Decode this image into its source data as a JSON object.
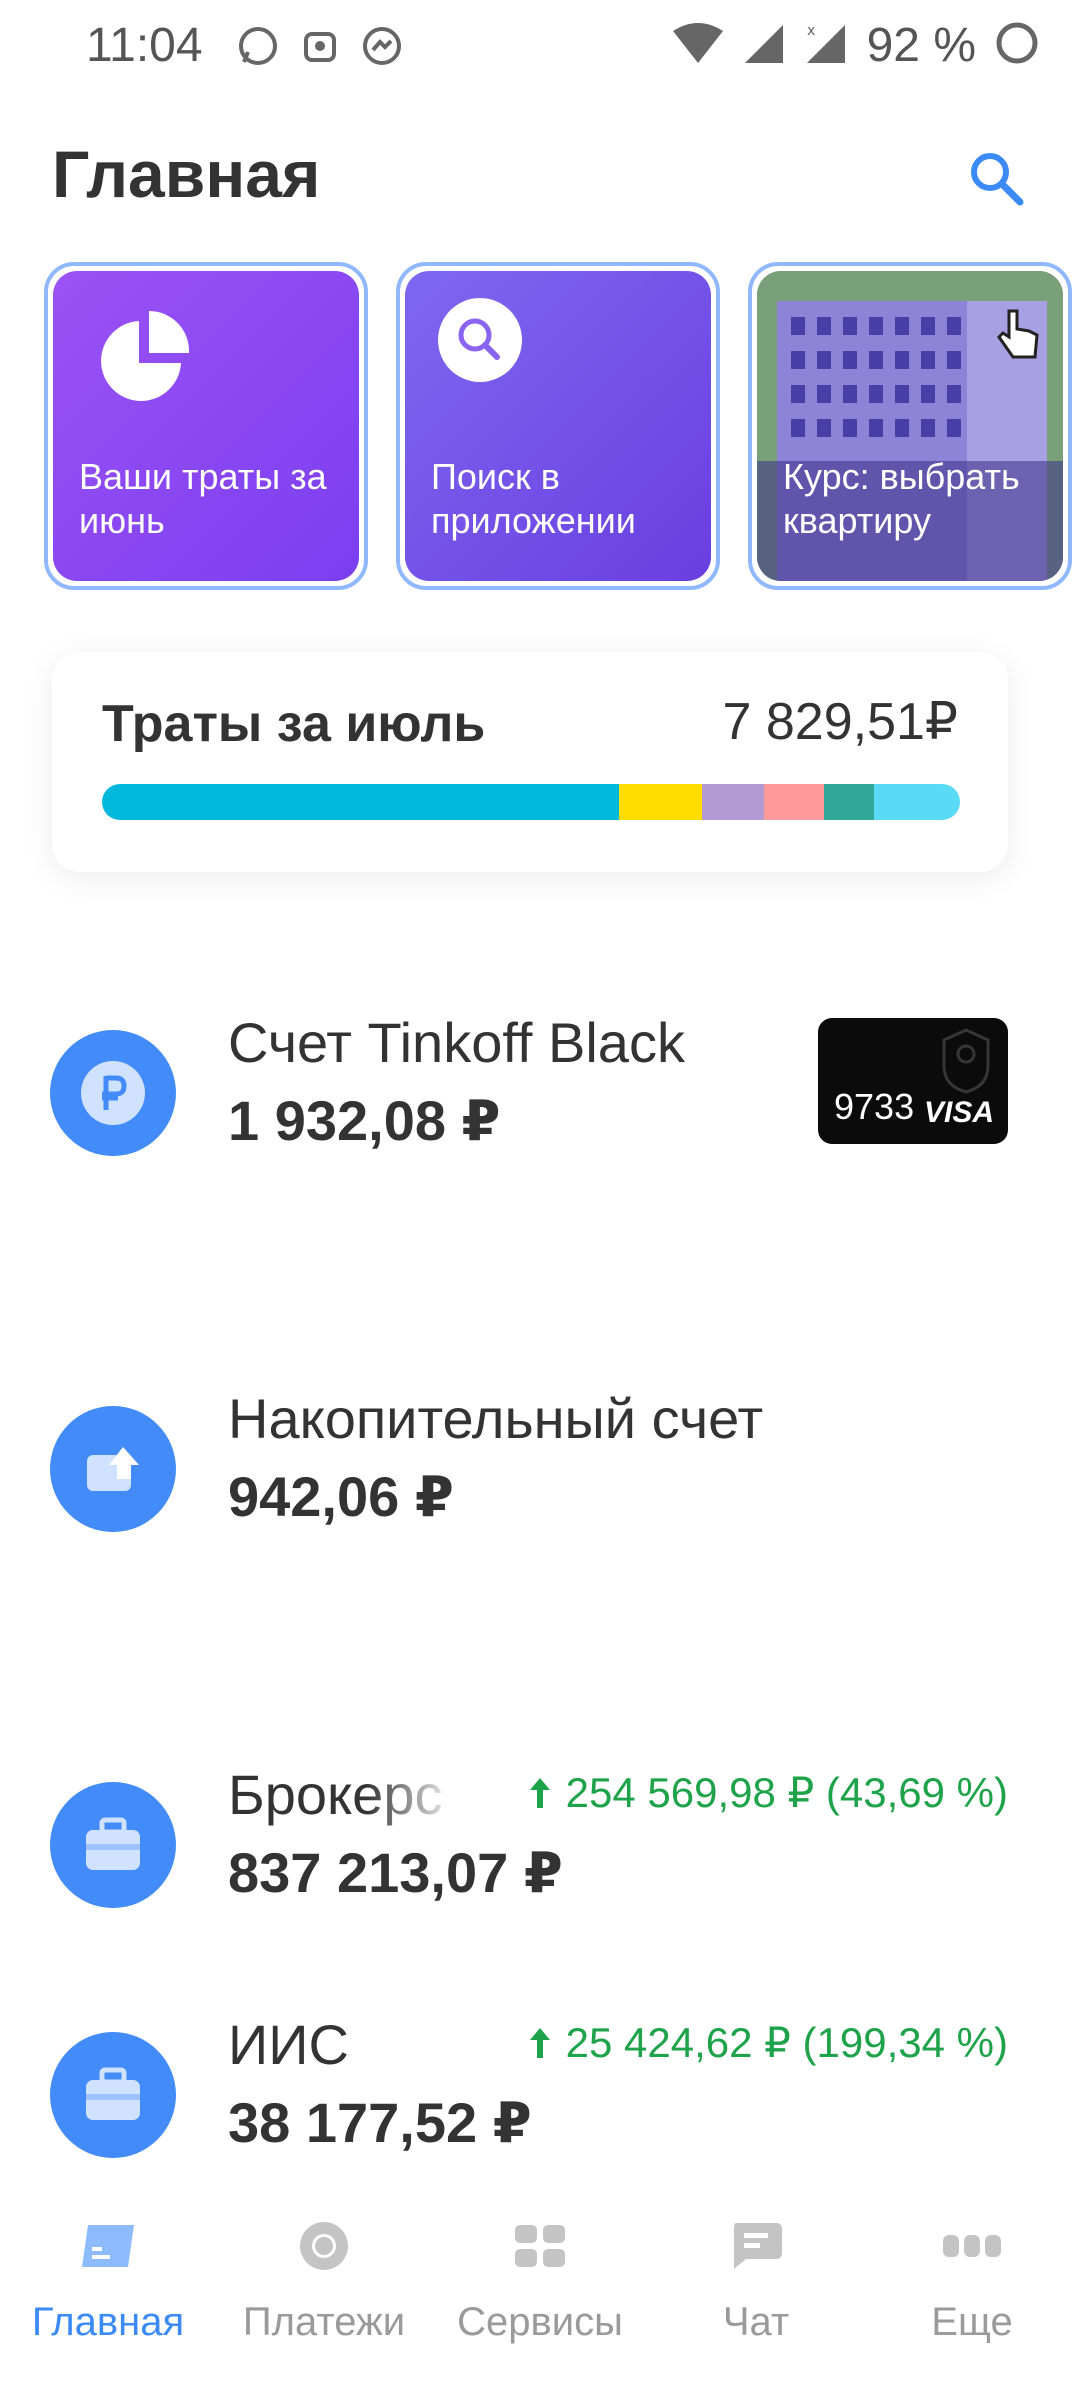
{
  "status_bar": {
    "time": "11:04",
    "battery": "92 %"
  },
  "header": {
    "title": "Главная"
  },
  "stories": [
    {
      "label": "Ваши траты за июнь"
    },
    {
      "label": "Поиск в приложении"
    },
    {
      "label": "Курс: выбрать квартиру"
    }
  ],
  "spending": {
    "title": "Траты за июль",
    "total": "7 829,51₽",
    "segments": [
      {
        "fraction": 0.603,
        "color": "#00b8dc"
      },
      {
        "fraction": 0.096,
        "color": "#ffdd00"
      },
      {
        "fraction": 0.073,
        "color": "#b39ad4"
      },
      {
        "fraction": 0.07,
        "color": "#ff9a9a"
      },
      {
        "fraction": 0.058,
        "color": "#30a79a"
      },
      {
        "fraction": 0.1,
        "color": "#5adbf5"
      }
    ]
  },
  "accounts": [
    {
      "name": "Счет Tinkoff Black",
      "balance": "1 932,08 ₽",
      "card_last4": "9733",
      "card_brand": "VISA"
    },
    {
      "name": "Накопительный счет",
      "balance": "942,06 ₽"
    },
    {
      "name": "Брокерс",
      "balance": "837 213,07 ₽",
      "change": "254 569,98 ₽ (43,69 %)"
    },
    {
      "name": "ИИС",
      "balance": "38 177,52 ₽",
      "change": "25 424,62 ₽ (199,34 %)"
    }
  ],
  "nav": [
    {
      "label": "Главная",
      "icon": "home-icon",
      "active": true
    },
    {
      "label": "Платежи",
      "icon": "payments-icon"
    },
    {
      "label": "Сервисы",
      "icon": "services-icon"
    },
    {
      "label": "Чат",
      "icon": "chat-icon"
    },
    {
      "label": "Еще",
      "icon": "more-icon"
    }
  ],
  "colors": {
    "accent": "#428bf9",
    "positive": "#1ea34a"
  }
}
